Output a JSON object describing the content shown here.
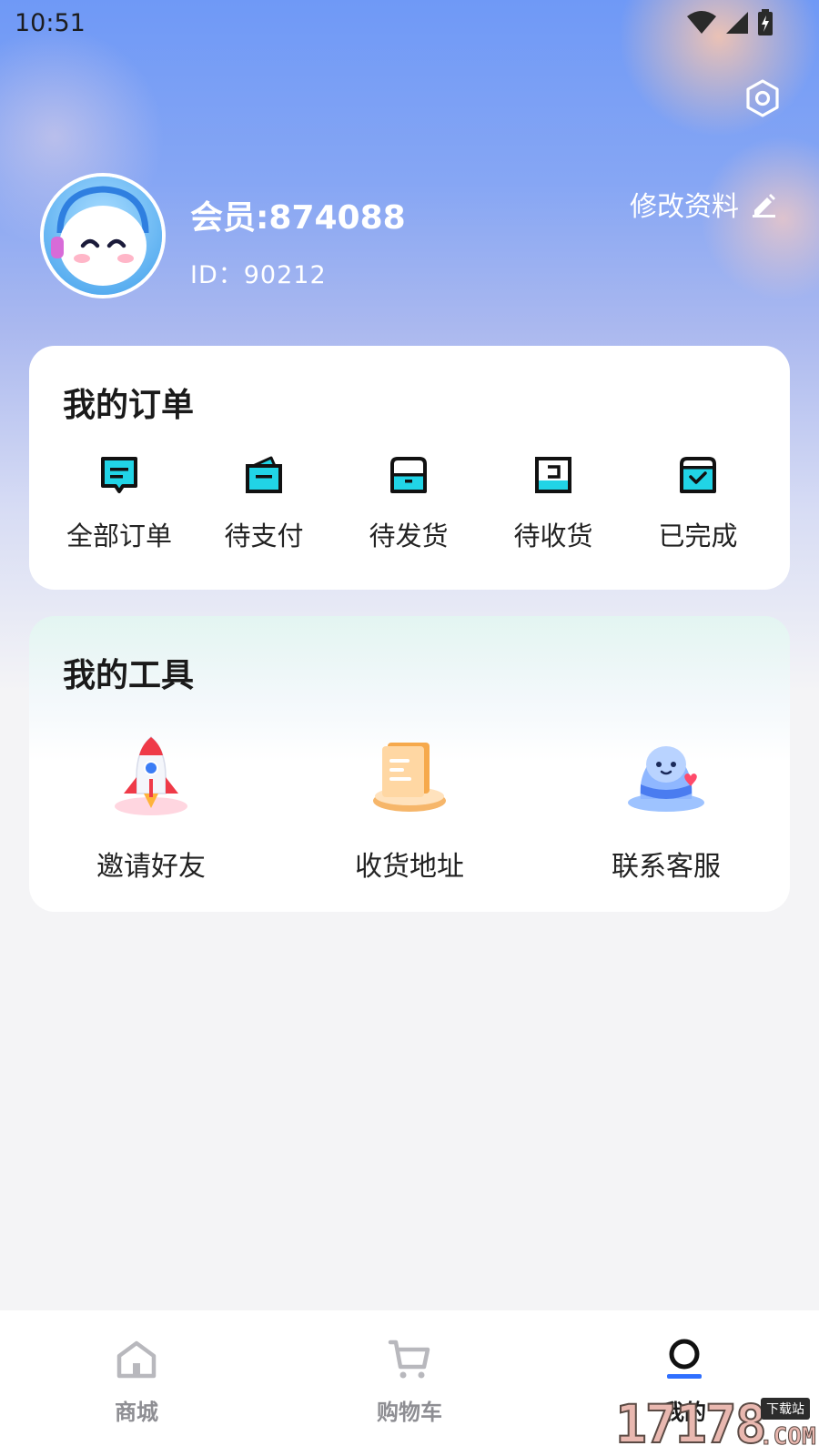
{
  "status_bar": {
    "time": "10:51",
    "icons": [
      "wifi-icon",
      "signal-icon",
      "battery-charging-icon"
    ]
  },
  "header": {
    "settings_icon": "settings-hexagon-icon",
    "member_name": "会员:874088",
    "member_id": "ID：90212",
    "edit_label": "修改资料",
    "edit_icon": "pencil-icon",
    "avatar": "cartoon-mascot-avatar"
  },
  "orders": {
    "title": "我的订单",
    "items": [
      {
        "label": "全部订单",
        "icon": "order-list-icon"
      },
      {
        "label": "待支付",
        "icon": "wallet-icon"
      },
      {
        "label": "待发货",
        "icon": "package-icon"
      },
      {
        "label": "待收货",
        "icon": "receive-icon"
      },
      {
        "label": "已完成",
        "icon": "completed-check-icon"
      }
    ]
  },
  "tools": {
    "title": "我的工具",
    "items": [
      {
        "label": "邀请好友",
        "icon": "rocket-icon"
      },
      {
        "label": "收货地址",
        "icon": "address-book-icon"
      },
      {
        "label": "联系客服",
        "icon": "service-mascot-icon"
      }
    ]
  },
  "tabbar": {
    "items": [
      {
        "label": "商城",
        "icon": "home-icon",
        "active": false
      },
      {
        "label": "购物车",
        "icon": "cart-icon",
        "active": false
      },
      {
        "label": "我的",
        "icon": "profile-icon",
        "active": true
      }
    ]
  },
  "watermark": {
    "number": "17178",
    "tag": "下载站",
    "domain": ".COM"
  },
  "colors": {
    "accent_blue": "#2f6fff",
    "accent_cyan": "#21d4e6",
    "text_dark": "#1a1a1a",
    "tab_inactive": "#8e8e93"
  }
}
